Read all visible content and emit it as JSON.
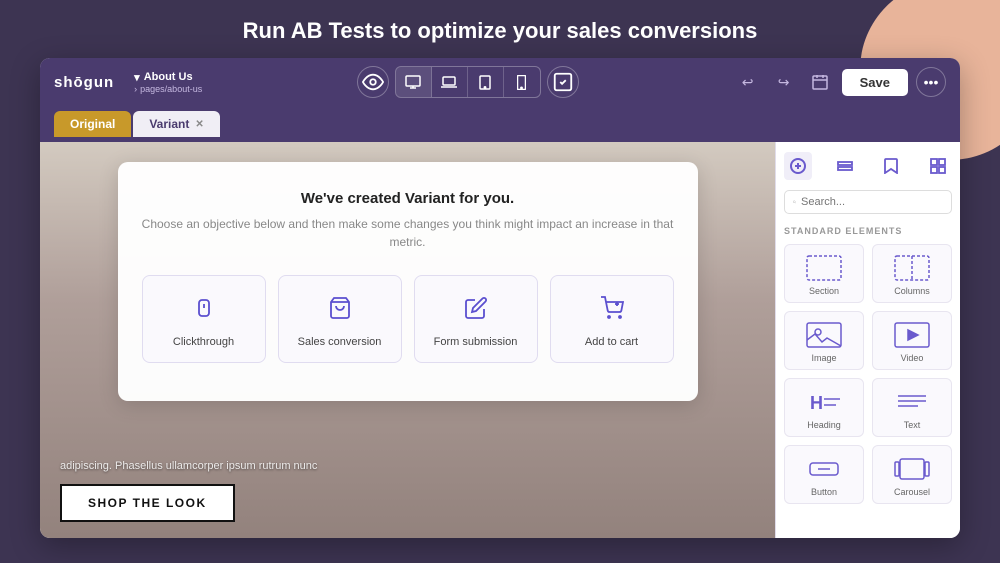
{
  "page": {
    "main_heading": "Run AB Tests to optimize your sales conversions"
  },
  "topbar": {
    "logo": "shōgun",
    "breadcrumb_title": "About Us",
    "breadcrumb_chevron": "▾",
    "breadcrumb_sub": "pages/about-us",
    "breadcrumb_sub_chevron": "›",
    "save_label": "Save",
    "more_label": "•••"
  },
  "tabs": {
    "original_label": "Original",
    "variant_label": "Variant",
    "variant_close": "✕"
  },
  "modal": {
    "title": "We've created Variant for you.",
    "subtitle": "Choose an objective below and then make some changes you\nthink might impact an increase in that metric.",
    "objectives": [
      {
        "id": "clickthrough",
        "label": "Clickthrough"
      },
      {
        "id": "sales-conversion",
        "label": "Sales conversion"
      },
      {
        "id": "form-submission",
        "label": "Form submission"
      },
      {
        "id": "add-to-cart",
        "label": "Add to cart"
      }
    ]
  },
  "canvas": {
    "lorem_text": "adipiscing. Phasellus ullamcorper ipsum rutrum nunc",
    "shop_button_label": "SHOP THE LOOK"
  },
  "right_panel": {
    "search_placeholder": "Search...",
    "section_label": "STANDARD ELEMENTS",
    "elements": [
      {
        "id": "section",
        "label": "Section"
      },
      {
        "id": "columns",
        "label": "Columns"
      },
      {
        "id": "image",
        "label": "Image"
      },
      {
        "id": "video",
        "label": "Video"
      },
      {
        "id": "heading",
        "label": "Heading"
      },
      {
        "id": "text",
        "label": "Text"
      },
      {
        "id": "button",
        "label": "Button"
      },
      {
        "id": "carousel",
        "label": "Carousel"
      }
    ]
  }
}
